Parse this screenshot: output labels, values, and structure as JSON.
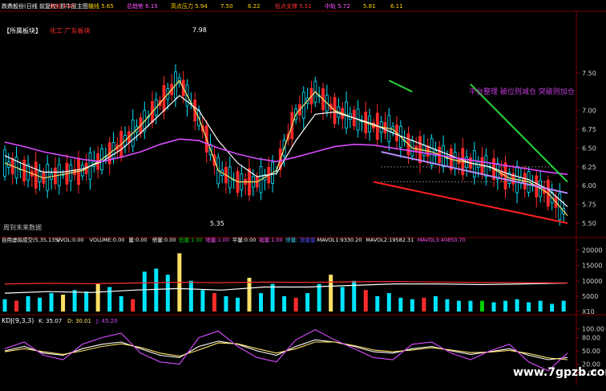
{
  "colors": {
    "bg": "#000000",
    "up": "#00e5ff",
    "down": "#ff2b2b",
    "yellow": "#ffe066",
    "ma_white": "#ffffff",
    "ma_magenta": "#d94cff",
    "trend_green": "#29d63a",
    "trend_red": "#ff1f1f",
    "trend_lavender": "#b88bff",
    "grid": "#7a0000",
    "label_red": "#ff3030",
    "label_yellow": "#ffd200",
    "label_green": "#00d000",
    "label_magenta": "#ff55ff",
    "label_cyan": "#35d6ff"
  },
  "header": {
    "title": "跌鼎般份(日线 前复权) 抓牛股主图",
    "fields": [
      {
        "label": "供线",
        "value": "5.67"
      },
      {
        "label": "機线",
        "value": "5.65"
      },
      {
        "label": "总趋势",
        "value": "6.15"
      },
      {
        "label": "高点压力",
        "value": "5.94"
      },
      {
        "label": "",
        "value": "7.50"
      },
      {
        "label": "",
        "value": "6.22"
      },
      {
        "label": "低点支撑",
        "value": "5.51"
      },
      {
        "label": "中轨",
        "value": "5.72"
      },
      {
        "label": "",
        "value": "5.81"
      },
      {
        "label": "",
        "value": "6.11"
      }
    ]
  },
  "main_panel": {
    "sector_tag": "【所属板块】",
    "sector_names": "化工 广东板块",
    "note_left": "周到末来数据",
    "overlay_text": "平台整理 破位则减仓 突破则加仓",
    "high_marker": "7.98",
    "low_marker": "5.35"
  },
  "volume_panel": {
    "fields": [
      {
        "label": "自用虚拟成交(5,35,135)",
        "value": ""
      },
      {
        "label": "VVOL:",
        "value": "0.00"
      },
      {
        "label": "VOLUME:",
        "value": "0.00"
      },
      {
        "label": "量:",
        "value": "0.00"
      },
      {
        "label": "倍量:",
        "value": "0.00"
      },
      {
        "label": "低量:",
        "value": "1.00"
      },
      {
        "label": "地量:",
        "value": "1.00"
      },
      {
        "label": "平量:",
        "value": "0.00"
      },
      {
        "label": "缩量:",
        "value": "1.00"
      },
      {
        "label": "倍量:",
        "value": ""
      },
      {
        "label": "放量量:",
        "value": ""
      },
      {
        "label": "MAVOL1:",
        "value": "9330.20"
      },
      {
        "label": "MAVOL2:",
        "value": "19582.31"
      },
      {
        "label": "MAVOL3:",
        "value": "40850.70"
      }
    ]
  },
  "kdj_panel": {
    "title": "KDJ(9,3,3)",
    "fields": [
      {
        "label": "K:",
        "value": "35.07"
      },
      {
        "label": "D:",
        "value": "30.01"
      },
      {
        "label": "J:",
        "value": "45.20"
      }
    ]
  },
  "watermark": "www.7gpzb.com",
  "chart_data": [
    {
      "type": "line",
      "title": "",
      "description": "Daily candlestick price chart with moving averages and trend lines",
      "x": [
        1,
        6,
        11,
        16,
        21,
        26,
        31,
        36,
        41,
        46,
        51,
        56,
        61,
        66,
        71,
        76,
        81,
        86,
        91,
        96,
        101,
        106,
        111,
        116,
        121,
        126,
        131,
        136,
        141,
        146
      ],
      "ylim": [
        5.35,
        7.98
      ],
      "yticks": [
        "7.50",
        "7.00",
        "6.75",
        "6.50",
        "6.25",
        "6.00",
        "5.75",
        "5.50"
      ],
      "series": [
        {
          "values": [
            6.3,
            6.2,
            6.1,
            6.15,
            6.2,
            6.35,
            6.55,
            6.8,
            7.1,
            7.4,
            6.9,
            6.2,
            6.05,
            6.05,
            6.2,
            6.95,
            7.25,
            7.0,
            6.9,
            6.8,
            6.75,
            6.5,
            6.45,
            6.35,
            6.3,
            6.25,
            6.1,
            6.05,
            5.9,
            5.6
          ]
        },
        {
          "values": [
            6.4,
            6.28,
            6.18,
            6.18,
            6.22,
            6.32,
            6.48,
            6.7,
            6.95,
            7.2,
            7.0,
            6.6,
            6.3,
            6.12,
            6.16,
            6.6,
            6.95,
            6.98,
            6.9,
            6.82,
            6.7,
            6.6,
            6.5,
            6.4,
            6.3,
            6.25,
            6.15,
            6.08,
            5.95,
            5.72
          ]
        },
        {
          "values": [
            6.58,
            6.52,
            6.45,
            6.4,
            6.35,
            6.32,
            6.38,
            6.45,
            6.55,
            6.62,
            6.6,
            6.5,
            6.42,
            6.36,
            6.32,
            6.38,
            6.45,
            6.52,
            6.55,
            6.54,
            6.5,
            6.46,
            6.42,
            6.38,
            6.34,
            6.3,
            6.26,
            6.22,
            6.18,
            6.15
          ]
        }
      ],
      "trendlines": [
        {
          "x": [
            121,
            146
          ],
          "values": [
            7.35,
            6.05
          ]
        },
        {
          "x": [
            96,
            146
          ],
          "values": [
            6.05,
            5.5
          ]
        },
        {
          "x": [
            98,
            146
          ],
          "values": [
            6.45,
            5.9
          ]
        },
        {
          "x": [
            100,
            106
          ],
          "values": [
            7.4,
            7.25
          ]
        }
      ]
    },
    {
      "type": "bar",
      "title": "",
      "description": "Volume bars",
      "x": [
        1,
        4,
        7,
        10,
        13,
        16,
        19,
        22,
        25,
        28,
        31,
        34,
        37,
        40,
        43,
        46,
        49,
        52,
        55,
        58,
        61,
        64,
        67,
        70,
        73,
        76,
        79,
        82,
        85,
        88,
        91,
        94,
        97,
        100,
        103,
        106,
        109,
        112,
        115,
        118,
        121,
        124,
        127,
        130,
        133,
        136,
        139,
        142,
        145
      ],
      "values": [
        4000,
        3500,
        5000,
        4500,
        6000,
        5500,
        7000,
        6500,
        9000,
        8000,
        5000,
        4000,
        13000,
        14000,
        12000,
        19000,
        10000,
        7000,
        6000,
        5000,
        4500,
        11000,
        6000,
        9000,
        5000,
        4500,
        6000,
        9000,
        12000,
        8000,
        10000,
        7000,
        5000,
        6000,
        4500,
        4000,
        4500,
        5000,
        4000,
        3500,
        3500,
        3500,
        3000,
        3500,
        4000,
        3000,
        3500,
        2500,
        3500
      ],
      "colors": [
        "up",
        "down",
        "up",
        "up",
        "up",
        "yellow",
        "up",
        "up",
        "yellow",
        "up",
        "up",
        "down",
        "up",
        "up",
        "up",
        "yellow",
        "up",
        "up",
        "down",
        "up",
        "up",
        "yellow",
        "up",
        "up",
        "up",
        "down",
        "up",
        "up",
        "yellow",
        "up",
        "up",
        "down",
        "up",
        "up",
        "up",
        "up",
        "down",
        "up",
        "up",
        "up",
        "up",
        "green",
        "up",
        "up",
        "up",
        "up",
        "up",
        "up",
        "up"
      ],
      "mavol": [
        6000,
        6500,
        6200,
        7000,
        7500,
        7000,
        8000,
        8000,
        8500,
        9000,
        9000,
        8800,
        9000,
        9300
      ],
      "mavol_long": [
        9000,
        9200,
        9100,
        9300,
        9500,
        9400,
        9600,
        9500,
        9700,
        9800,
        9600,
        9500,
        9400,
        9300
      ],
      "yticks": [
        "20000",
        "15000",
        "10000",
        "5000",
        "X10"
      ]
    },
    {
      "type": "line",
      "title": "",
      "description": "KDJ oscillator",
      "x": [
        1,
        6,
        11,
        16,
        21,
        26,
        31,
        36,
        41,
        46,
        51,
        56,
        61,
        66,
        71,
        76,
        81,
        86,
        91,
        96,
        101,
        106,
        111,
        116,
        121,
        126,
        131,
        136,
        141,
        146
      ],
      "ylim": [
        -10,
        110
      ],
      "yticks": [
        "100.00",
        "80.00",
        "50.00",
        "20.00",
        "0.00"
      ],
      "series": [
        {
          "name": "K",
          "values": [
            50,
            60,
            45,
            40,
            55,
            65,
            70,
            55,
            40,
            35,
            60,
            72,
            65,
            50,
            40,
            60,
            75,
            70,
            60,
            48,
            45,
            55,
            60,
            50,
            42,
            48,
            55,
            40,
            30,
            35
          ]
        },
        {
          "name": "D",
          "values": [
            48,
            55,
            48,
            42,
            50,
            60,
            66,
            58,
            45,
            38,
            52,
            68,
            66,
            55,
            45,
            55,
            70,
            70,
            62,
            52,
            48,
            52,
            57,
            52,
            46,
            47,
            51,
            44,
            34,
            30
          ]
        },
        {
          "name": "J",
          "values": [
            55,
            70,
            40,
            30,
            65,
            80,
            90,
            45,
            25,
            20,
            80,
            95,
            60,
            35,
            25,
            75,
            98,
            75,
            55,
            35,
            30,
            65,
            70,
            45,
            30,
            50,
            65,
            25,
            5,
            45
          ]
        }
      ]
    }
  ]
}
